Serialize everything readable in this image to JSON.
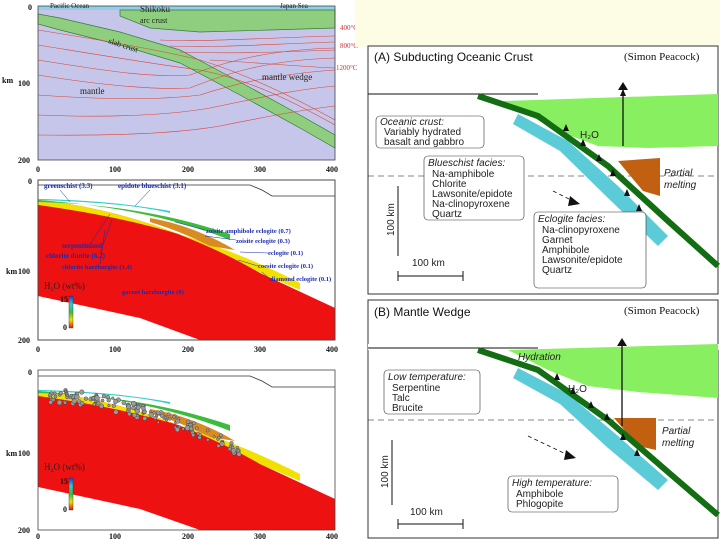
{
  "panel1": {
    "labels": {
      "pacific": "Pacific Ocean",
      "shikoku": "Shikoku",
      "japan_sea": "Japan Sea",
      "arc_crust": "arc crust",
      "slab_crust": "slab crust",
      "mantle": "mantle",
      "mantle_wedge": "mantle wedge",
      "km": "km"
    },
    "isotherms": [
      "400°C",
      "800°C",
      "1200°C"
    ],
    "x_ticks": [
      "0",
      "100",
      "200",
      "300",
      "400"
    ],
    "y_ticks": [
      "0",
      "100",
      "200"
    ]
  },
  "panel2": {
    "facies": [
      "greenschist (3.3)",
      "epidote blueschist (3.1)",
      "zoisite amphibole eclogite (0.7)",
      "zoisite eclogite (0.3)",
      "eclogite (0.1)",
      "coesite eclogite (0.1)",
      "diamond eclogite (0.1)",
      "serpentinized",
      "chlorite dunite (6.2)",
      "chlorite harzburgite (1.4)",
      "garnet harzburgite (0)"
    ],
    "legend_title": "H₂O (wt%)",
    "legend_max": "15",
    "legend_min": "0",
    "km": "km",
    "x_ticks": [
      "0",
      "100",
      "200",
      "300",
      "400"
    ],
    "y_ticks": [
      "0",
      "100",
      "200"
    ]
  },
  "panel3": {
    "legend_title": "H₂O (wt%)",
    "legend_max": "15",
    "legend_min": "0",
    "km": "km",
    "x_ticks": [
      "0",
      "100",
      "200",
      "300",
      "400"
    ],
    "y_ticks": [
      "0",
      "100",
      "200"
    ]
  },
  "panelA": {
    "title": "(A) Subducting Oceanic Crust",
    "credit": "(Simon Peacock)",
    "oceanic_crust": [
      "Oceanic crust:",
      "Variably hydrated",
      "basalt and gabbro"
    ],
    "blueschist": [
      "Blueschist facies:",
      "Na-amphibole",
      "Chlorite",
      "Lawsonite/epidote",
      "Na-clinopyroxene",
      "Quartz"
    ],
    "eclogite": [
      "Eclogite facies:",
      "Na-clinopyroxene",
      "Garnet",
      "Amphibole",
      "Lawsonite/epidote",
      "Quartz"
    ],
    "h2o": "H₂O",
    "partial_melting": [
      "Partial",
      "melting"
    ],
    "scale_km": "100 km",
    "vert_km": "100 km"
  },
  "panelB": {
    "title": "(B) Mantle Wedge",
    "credit": "(Simon Peacock)",
    "hydration": "Hydration",
    "low_temp": [
      "Low temperature:",
      "Serpentine",
      "Talc",
      "Brucite"
    ],
    "high_temp": [
      "High temperature:",
      "Amphibole",
      "Phlogopite"
    ],
    "h2o": "H₂O",
    "partial_melting": [
      "Partial",
      "melting"
    ],
    "scale_km": "100 km",
    "vert_km": "100 km"
  },
  "colors": {
    "mantle_lavender": "#c5c6e9",
    "slab_green": "#8fce7e",
    "wedge_green": "#88f060",
    "water_cyan": "#5ccbd8",
    "melt_brown": "#c06010",
    "slab_dark": "#136d13",
    "red": "#ee1111"
  }
}
